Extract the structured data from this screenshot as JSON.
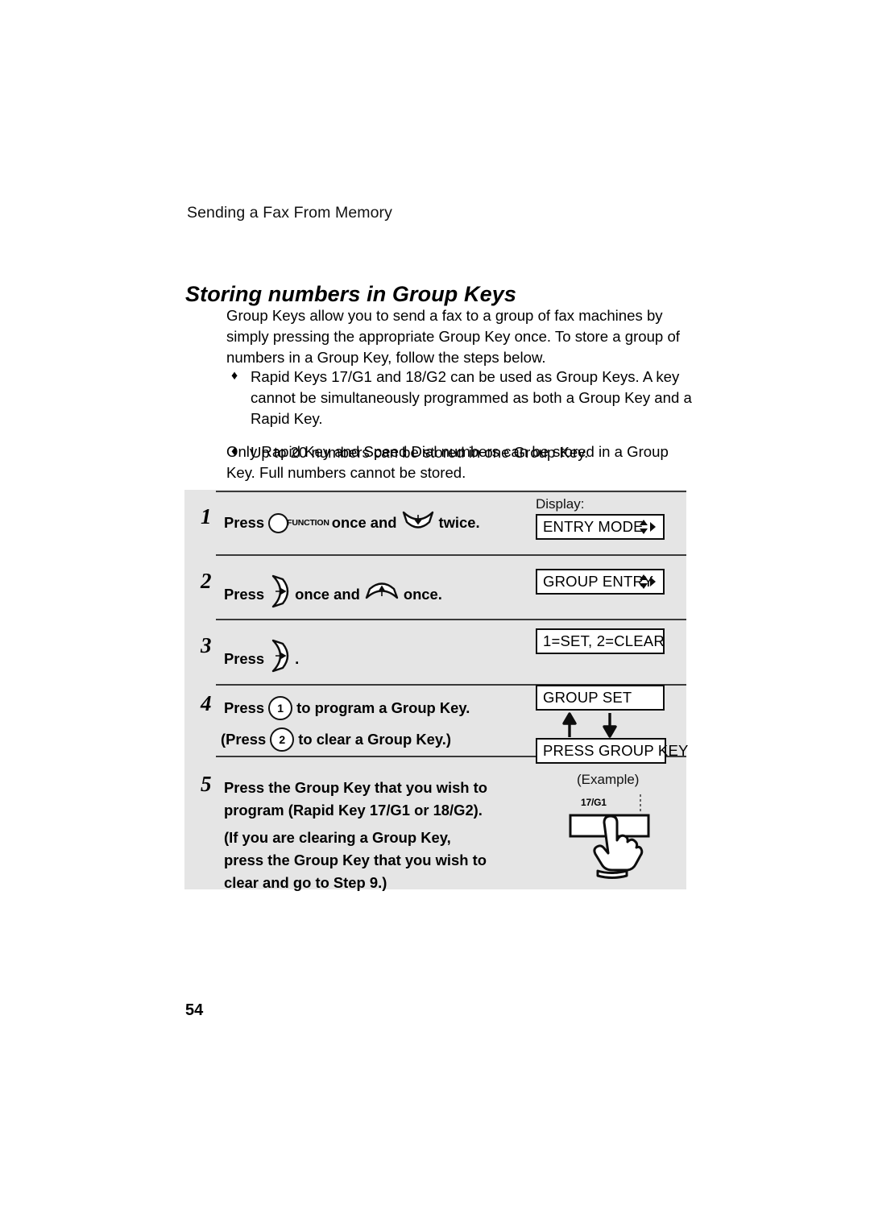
{
  "page": {
    "running_head": "Sending a Fax From Memory",
    "section_title": "Storing numbers in Group Keys",
    "page_number": "54"
  },
  "intro": {
    "paragraph_1": "Group Keys allow you to send a fax to a group of fax machines by simply pressing the appropriate Group Key once. To store a group of numbers in a Group Key, follow the steps below.",
    "bullets": [
      "Rapid Keys 17/G1 and 18/G2 can be used as Group Keys. A key cannot be simultaneously programmed as both a Group Key and a Rapid Key.",
      "Up to 20 numbers can be stored in one Group Key."
    ],
    "bullet_glyph": "♦",
    "paragraph_2": "Only Rapid Key and Speed Dial numbers can be stored in a Group Key. Full numbers cannot be stored."
  },
  "steps": {
    "display_label": "Display:",
    "example_label": "(Example)",
    "step1": {
      "number": "1",
      "press_word": "Press",
      "function_key_label": "FUNCTION",
      "mid_text": "once and",
      "end_text": "twice.",
      "display_value": "ENTRY MODE"
    },
    "step2": {
      "number": "2",
      "press_word": "Press",
      "mid_text": "once and",
      "end_text": "once.",
      "display_value": "GROUP ENTRY"
    },
    "step3": {
      "number": "3",
      "press_word": "Press",
      "end_text": ".",
      "display_value": "1=SET, 2=CLEAR"
    },
    "step4": {
      "number": "4",
      "line1_pre": "Press",
      "line1_key": "1",
      "line1_post": "to program a Group Key.",
      "line2_pre": "(Press",
      "line2_key": "2",
      "line2_post": "to clear a Group Key.)",
      "display_value_top": "GROUP SET",
      "display_value_bottom": "PRESS GROUP KEY"
    },
    "step5": {
      "number": "5",
      "paragraph_1": "Press the Group Key that you wish to program (Rapid Key 17/G1 or 18/G2).",
      "paragraph_2": "(If you are clearing a Group Key, press the Group Key that you wish to clear and go to Step 9.)",
      "rapid_key_label": "17/G1"
    }
  },
  "colors": {
    "panel_background": "#e5e5e5",
    "rule": "#3a3a3a",
    "ink": "#000000",
    "display_background": "#ffffff"
  }
}
